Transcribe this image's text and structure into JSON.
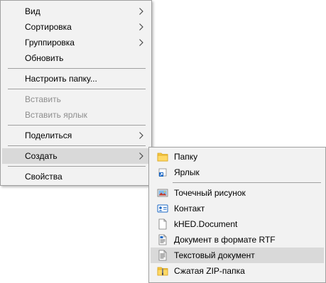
{
  "context_menu": {
    "items": [
      {
        "label": "Вид",
        "has_submenu": true
      },
      {
        "label": "Сортировка",
        "has_submenu": true
      },
      {
        "label": "Группировка",
        "has_submenu": true
      },
      {
        "label": "Обновить"
      },
      {
        "label": "Настроить папку..."
      },
      {
        "label": "Вставить",
        "disabled": true
      },
      {
        "label": "Вставить ярлык",
        "disabled": true
      },
      {
        "label": "Поделиться",
        "has_submenu": true
      },
      {
        "label": "Создать",
        "has_submenu": true,
        "highlighted": true
      },
      {
        "label": "Свойства"
      }
    ]
  },
  "create_submenu": {
    "items": [
      {
        "label": "Папку",
        "icon": "folder-icon"
      },
      {
        "label": "Ярлык",
        "icon": "shortcut-icon"
      },
      {
        "label": "Точечный рисунок",
        "icon": "bitmap-icon"
      },
      {
        "label": "Контакт",
        "icon": "contact-icon"
      },
      {
        "label": "kHED.Document",
        "icon": "blank-document-icon"
      },
      {
        "label": "Документ в формате RTF",
        "icon": "rtf-document-icon"
      },
      {
        "label": "Текстовый документ",
        "icon": "text-document-icon",
        "highlighted": true
      },
      {
        "label": "Сжатая ZIP-папка",
        "icon": "zip-folder-icon"
      }
    ]
  },
  "colors": {
    "menu_background": "#f2f2f2",
    "highlight": "#d9d9d9",
    "disabled_text": "#8e8e8e",
    "separator": "#a0a0a0",
    "folder": "#f5c842"
  }
}
